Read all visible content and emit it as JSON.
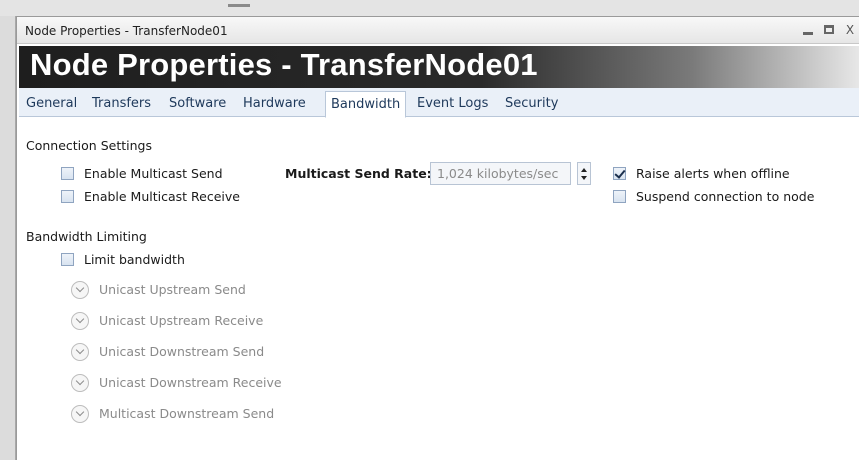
{
  "window": {
    "title": "Node Properties - TransferNode01",
    "controls": {
      "minimize": "minimize-icon",
      "maximize": "maximize-icon",
      "close": "X"
    }
  },
  "banner": {
    "title": "Node Properties - TransferNode01"
  },
  "tabs": [
    {
      "label": "General",
      "active": false
    },
    {
      "label": "Transfers",
      "active": false
    },
    {
      "label": "Software",
      "active": false
    },
    {
      "label": "Hardware",
      "active": false
    },
    {
      "label": "Bandwidth",
      "active": true
    },
    {
      "label": "Event Logs",
      "active": false
    },
    {
      "label": "Security",
      "active": false
    }
  ],
  "connection_settings": {
    "heading": "Connection Settings",
    "enable_multicast_send": {
      "label": "Enable Multicast Send",
      "checked": false
    },
    "enable_multicast_receive": {
      "label": "Enable Multicast Receive",
      "checked": false
    },
    "multicast_send_rate": {
      "label": "Multicast Send Rate:",
      "value": "1,024 kilobytes/sec"
    },
    "raise_alerts": {
      "label": "Raise alerts when offline",
      "checked": true
    },
    "suspend_connection": {
      "label": "Suspend connection to node",
      "checked": false
    }
  },
  "bandwidth_limiting": {
    "heading": "Bandwidth Limiting",
    "limit_bandwidth": {
      "label": "Limit bandwidth",
      "checked": false
    },
    "expanders": [
      {
        "label": "Unicast Upstream Send"
      },
      {
        "label": "Unicast Upstream Receive"
      },
      {
        "label": "Unicast Downstream Send"
      },
      {
        "label": "Unicast Downstream Receive"
      },
      {
        "label": "Multicast Downstream Send"
      }
    ]
  },
  "colors": {
    "banner_dark": "#1e1e1e",
    "tab_text": "#1e395b",
    "tab_strip": "#eaf0f8",
    "disabled_text": "#8a8a8a"
  }
}
